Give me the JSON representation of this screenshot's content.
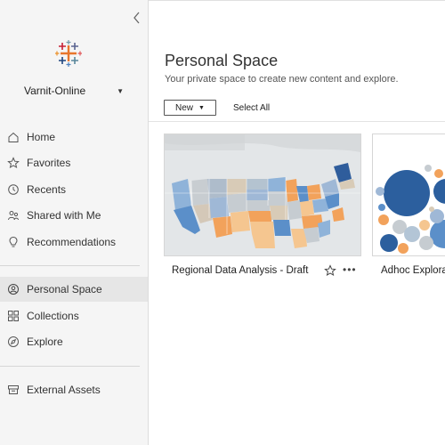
{
  "sidebar": {
    "site_name": "Varnit-Online",
    "items": [
      {
        "label": "Home",
        "icon": "home-icon"
      },
      {
        "label": "Favorites",
        "icon": "star-icon"
      },
      {
        "label": "Recents",
        "icon": "clock-icon"
      },
      {
        "label": "Shared with Me",
        "icon": "people-icon"
      },
      {
        "label": "Recommendations",
        "icon": "lightbulb-icon"
      },
      {
        "label": "Personal Space",
        "icon": "user-icon",
        "active": true
      },
      {
        "label": "Collections",
        "icon": "grid-icon"
      },
      {
        "label": "Explore",
        "icon": "compass-icon"
      },
      {
        "label": "External Assets",
        "icon": "database-icon"
      }
    ]
  },
  "main": {
    "title": "Personal Space",
    "subtitle": "Your private space to create new content and explore.",
    "new_label": "New",
    "select_all_label": "Select All",
    "cards": [
      {
        "title": "Regional Data Analysis - Draft"
      },
      {
        "title": "Adhoc Explorat"
      }
    ]
  },
  "colors": {
    "sidebar_bg": "#f5f5f5",
    "active_bg": "#e6e6e6",
    "map_blue": "#5b8fc9",
    "map_orange": "#f2a25b",
    "bubble_blue": "#2c5f9e"
  }
}
